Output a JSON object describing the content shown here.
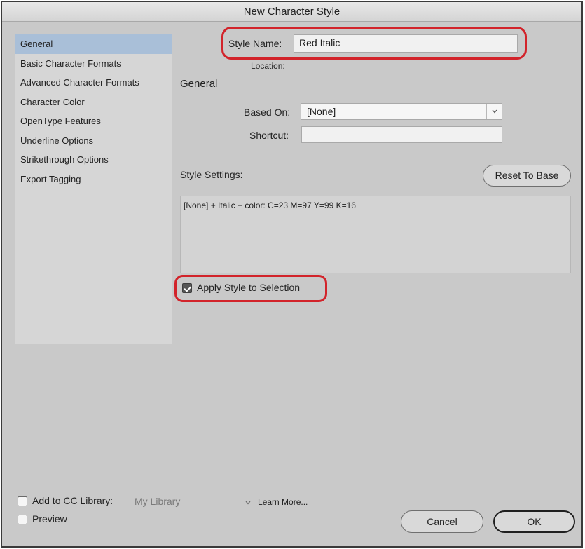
{
  "window": {
    "title": "New Character Style"
  },
  "sidebar": {
    "items": [
      {
        "label": "General"
      },
      {
        "label": "Basic Character Formats"
      },
      {
        "label": "Advanced Character Formats"
      },
      {
        "label": "Character Color"
      },
      {
        "label": "OpenType Features"
      },
      {
        "label": "Underline Options"
      },
      {
        "label": "Strikethrough Options"
      },
      {
        "label": "Export Tagging"
      }
    ],
    "selected": "General"
  },
  "form": {
    "style_name_label": "Style Name:",
    "style_name_value": "Red Italic",
    "location_label": "Location:",
    "section_title": "General",
    "based_on_label": "Based On:",
    "based_on_value": "[None]",
    "shortcut_label": "Shortcut:",
    "shortcut_value": "",
    "style_settings_label": "Style Settings:",
    "reset_to_base_label": "Reset To Base",
    "style_settings_text": "[None] + Italic + color: C=23 M=97 Y=99 K=16",
    "apply_style_label": "Apply Style to Selection",
    "apply_style_checked": true
  },
  "footer": {
    "add_to_cc_label": "Add to CC Library:",
    "add_to_cc_checked": false,
    "library_value": "My Library",
    "learn_more_label": "Learn More...",
    "preview_label": "Preview",
    "preview_checked": false,
    "cancel_label": "Cancel",
    "ok_label": "OK"
  },
  "colors": {
    "highlight": "#d2232a",
    "selected_item": "#a9bfd8",
    "dialog_bg": "#c9c9c9"
  },
  "icons": [
    "chevron-down-icon",
    "checkmark-icon"
  ]
}
